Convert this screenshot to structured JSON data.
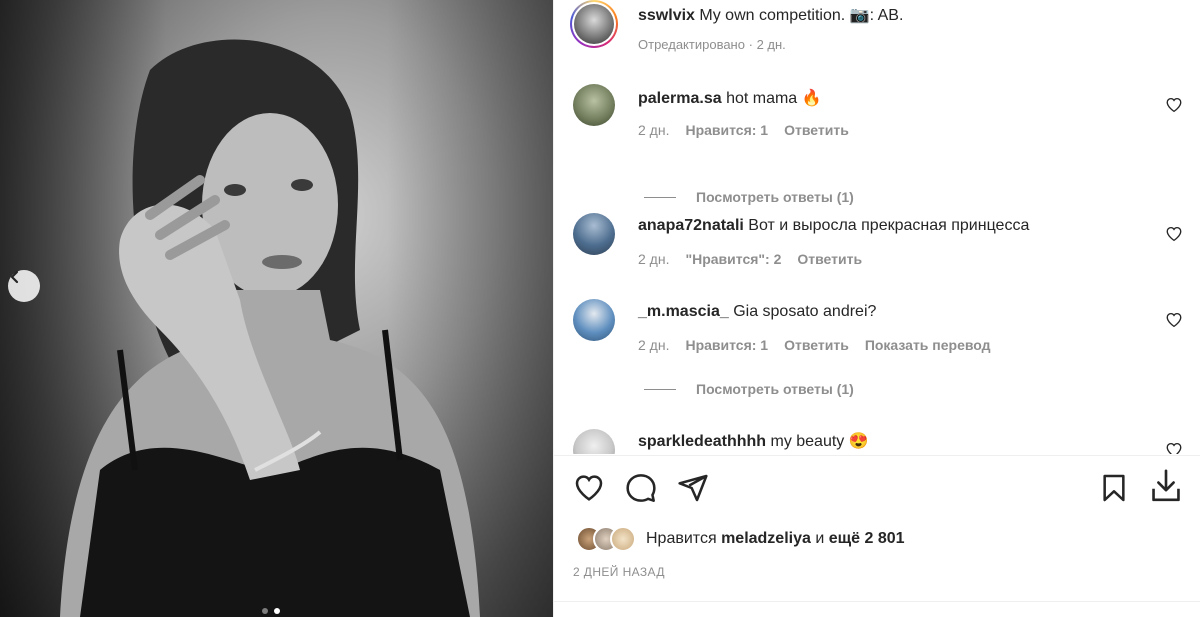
{
  "post": {
    "slide_index": 2,
    "slide_count": 2
  },
  "author": {
    "username": "sswlvix",
    "caption": "My own competition. 📷: AB.",
    "edited_label": "Отредактировано",
    "separator": "·",
    "time": "2 дн."
  },
  "comments": [
    {
      "username": "palerma.sa",
      "text": "hot mama 🔥",
      "time": "2 дн.",
      "likes": "Нравится: 1",
      "reply": "Ответить",
      "view_replies": "Посмотреть ответы (1)",
      "avatar_color": "#6f7b5a"
    },
    {
      "username": "anapa72natali",
      "text": "Вот и выросла прекрасная принцесса",
      "time": "2 дн.",
      "likes": "\"Нравится\": 2",
      "reply": "Ответить",
      "avatar_color": "#4d6d8f"
    },
    {
      "username": "_m.mascia_",
      "text": "Gia sposato andrei?",
      "time": "2 дн.",
      "likes": "Нравится: 1",
      "reply": "Ответить",
      "translate": "Показать перевод",
      "view_replies": "Посмотреть ответы (1)",
      "avatar_color": "#5f8fbf"
    },
    {
      "username": "sparkledeathhhh",
      "text": "my beauty 😍",
      "avatar_color": "#c8c8c8"
    }
  ],
  "actions": {
    "like": "heart-icon",
    "comment": "comment-icon",
    "share": "send-icon",
    "save": "bookmark-icon",
    "download": "download-icon"
  },
  "likes_line": {
    "prefix": "Нравится",
    "user": "meladzeliya",
    "conj": "и",
    "others": "ещё 2 801"
  },
  "date": "2 ДНЕЙ НАЗАД"
}
